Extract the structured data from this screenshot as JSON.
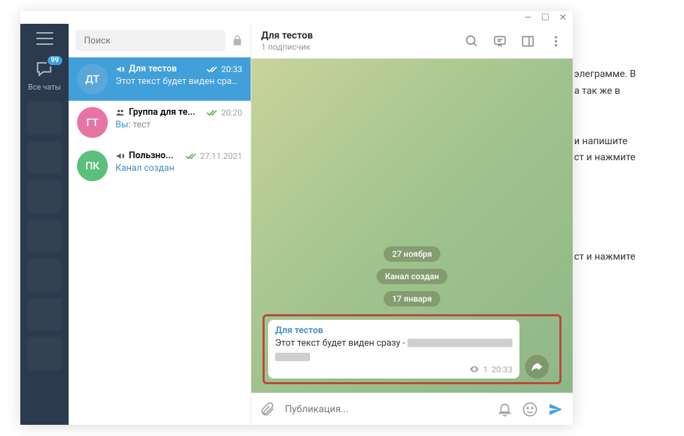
{
  "bg_text": {
    "l1": "элеграмме. В",
    "l2": "а так же в",
    "l3": "и напишите",
    "l4": "ст и нажмите",
    "l5": "ст и нажмите"
  },
  "sidebar": {
    "badge": "99",
    "all_chats": "Все чаты"
  },
  "search": {
    "placeholder": "Поиск"
  },
  "chats": [
    {
      "avatar": "ДТ",
      "name": "Для тестов",
      "time": "20:33",
      "sub": "Этот текст будет виден сраз..."
    },
    {
      "avatar": "ГТ",
      "name": "Группа для те...",
      "time": "20:20",
      "you": "Вы:",
      "sub": " тест"
    },
    {
      "avatar": "ПК",
      "name": "Пользно...",
      "time": "27.11.2021",
      "created": "Канал создан"
    }
  ],
  "conv": {
    "title": "Для тестов",
    "subtitle": "1 подписчик",
    "pills": {
      "p1": "27 ноября",
      "p2": "Канал создан",
      "p3": "17 января"
    },
    "msg": {
      "author": "Для тестов",
      "text_prefix": "Этот текст будет виден сразу - ",
      "views": "1",
      "time": "20:33"
    }
  },
  "composer": {
    "placeholder": "Публикация..."
  }
}
